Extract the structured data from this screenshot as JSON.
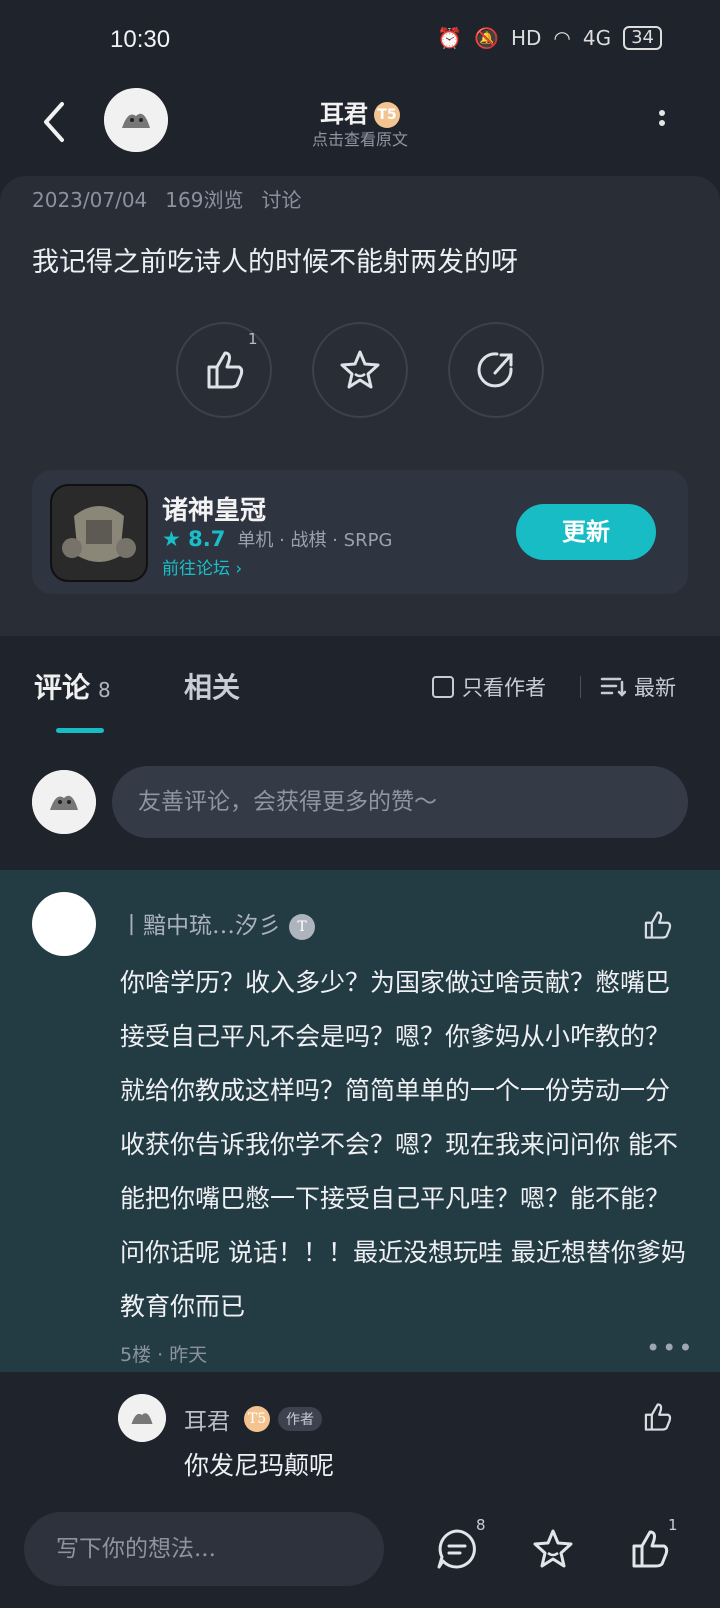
{
  "status_bar": {
    "time": "10:30",
    "battery": "34",
    "network": "4G"
  },
  "header": {
    "title": "耳君",
    "level": "T5",
    "subtitle": "点击查看原文"
  },
  "post": {
    "date": "2023/07/04",
    "views": "169浏览",
    "category": "讨论",
    "content": "我记得之前吃诗人的时候不能射两发的呀",
    "like_count": "1"
  },
  "game": {
    "name": "诸神皇冠",
    "rating": "8.7",
    "tags": "单机 · 战棋 · SRPG",
    "link": "前往论坛",
    "button": "更新"
  },
  "tabs": {
    "comments_label": "评论",
    "comments_count": "8",
    "related_label": "相关",
    "author_only": "只看作者",
    "sort": "最新"
  },
  "comment_input": {
    "placeholder": "友善评论，会获得更多的赞～"
  },
  "highlighted_comment": {
    "user": "丨黯中琉…汐彡",
    "body": "你啥学历？收入多少？为国家做过啥贡献？憋嘴巴接受自己平凡不会是吗？嗯？你爹妈从小咋教的？就给你教成这样吗？简简单单的一个一份劳动一分收获你告诉我你学不会？嗯？现在我来问问你 能不能把你嘴巴憋一下接受自己平凡哇？嗯？能不能？问你话呢 说话！！！最近没想玩哇 最近想替你爹妈教育你而已",
    "floor": "5楼 · 昨天"
  },
  "reply": {
    "user": "耳君",
    "author_tag": "作者",
    "body": "你发尼玛颠呢"
  },
  "bottom_bar": {
    "placeholder": "写下你的想法...",
    "comment_count": "8",
    "like_count": "1"
  },
  "colors": {
    "accent": "#17bcc4",
    "background": "#1f232b",
    "highlight": "#233b43"
  }
}
